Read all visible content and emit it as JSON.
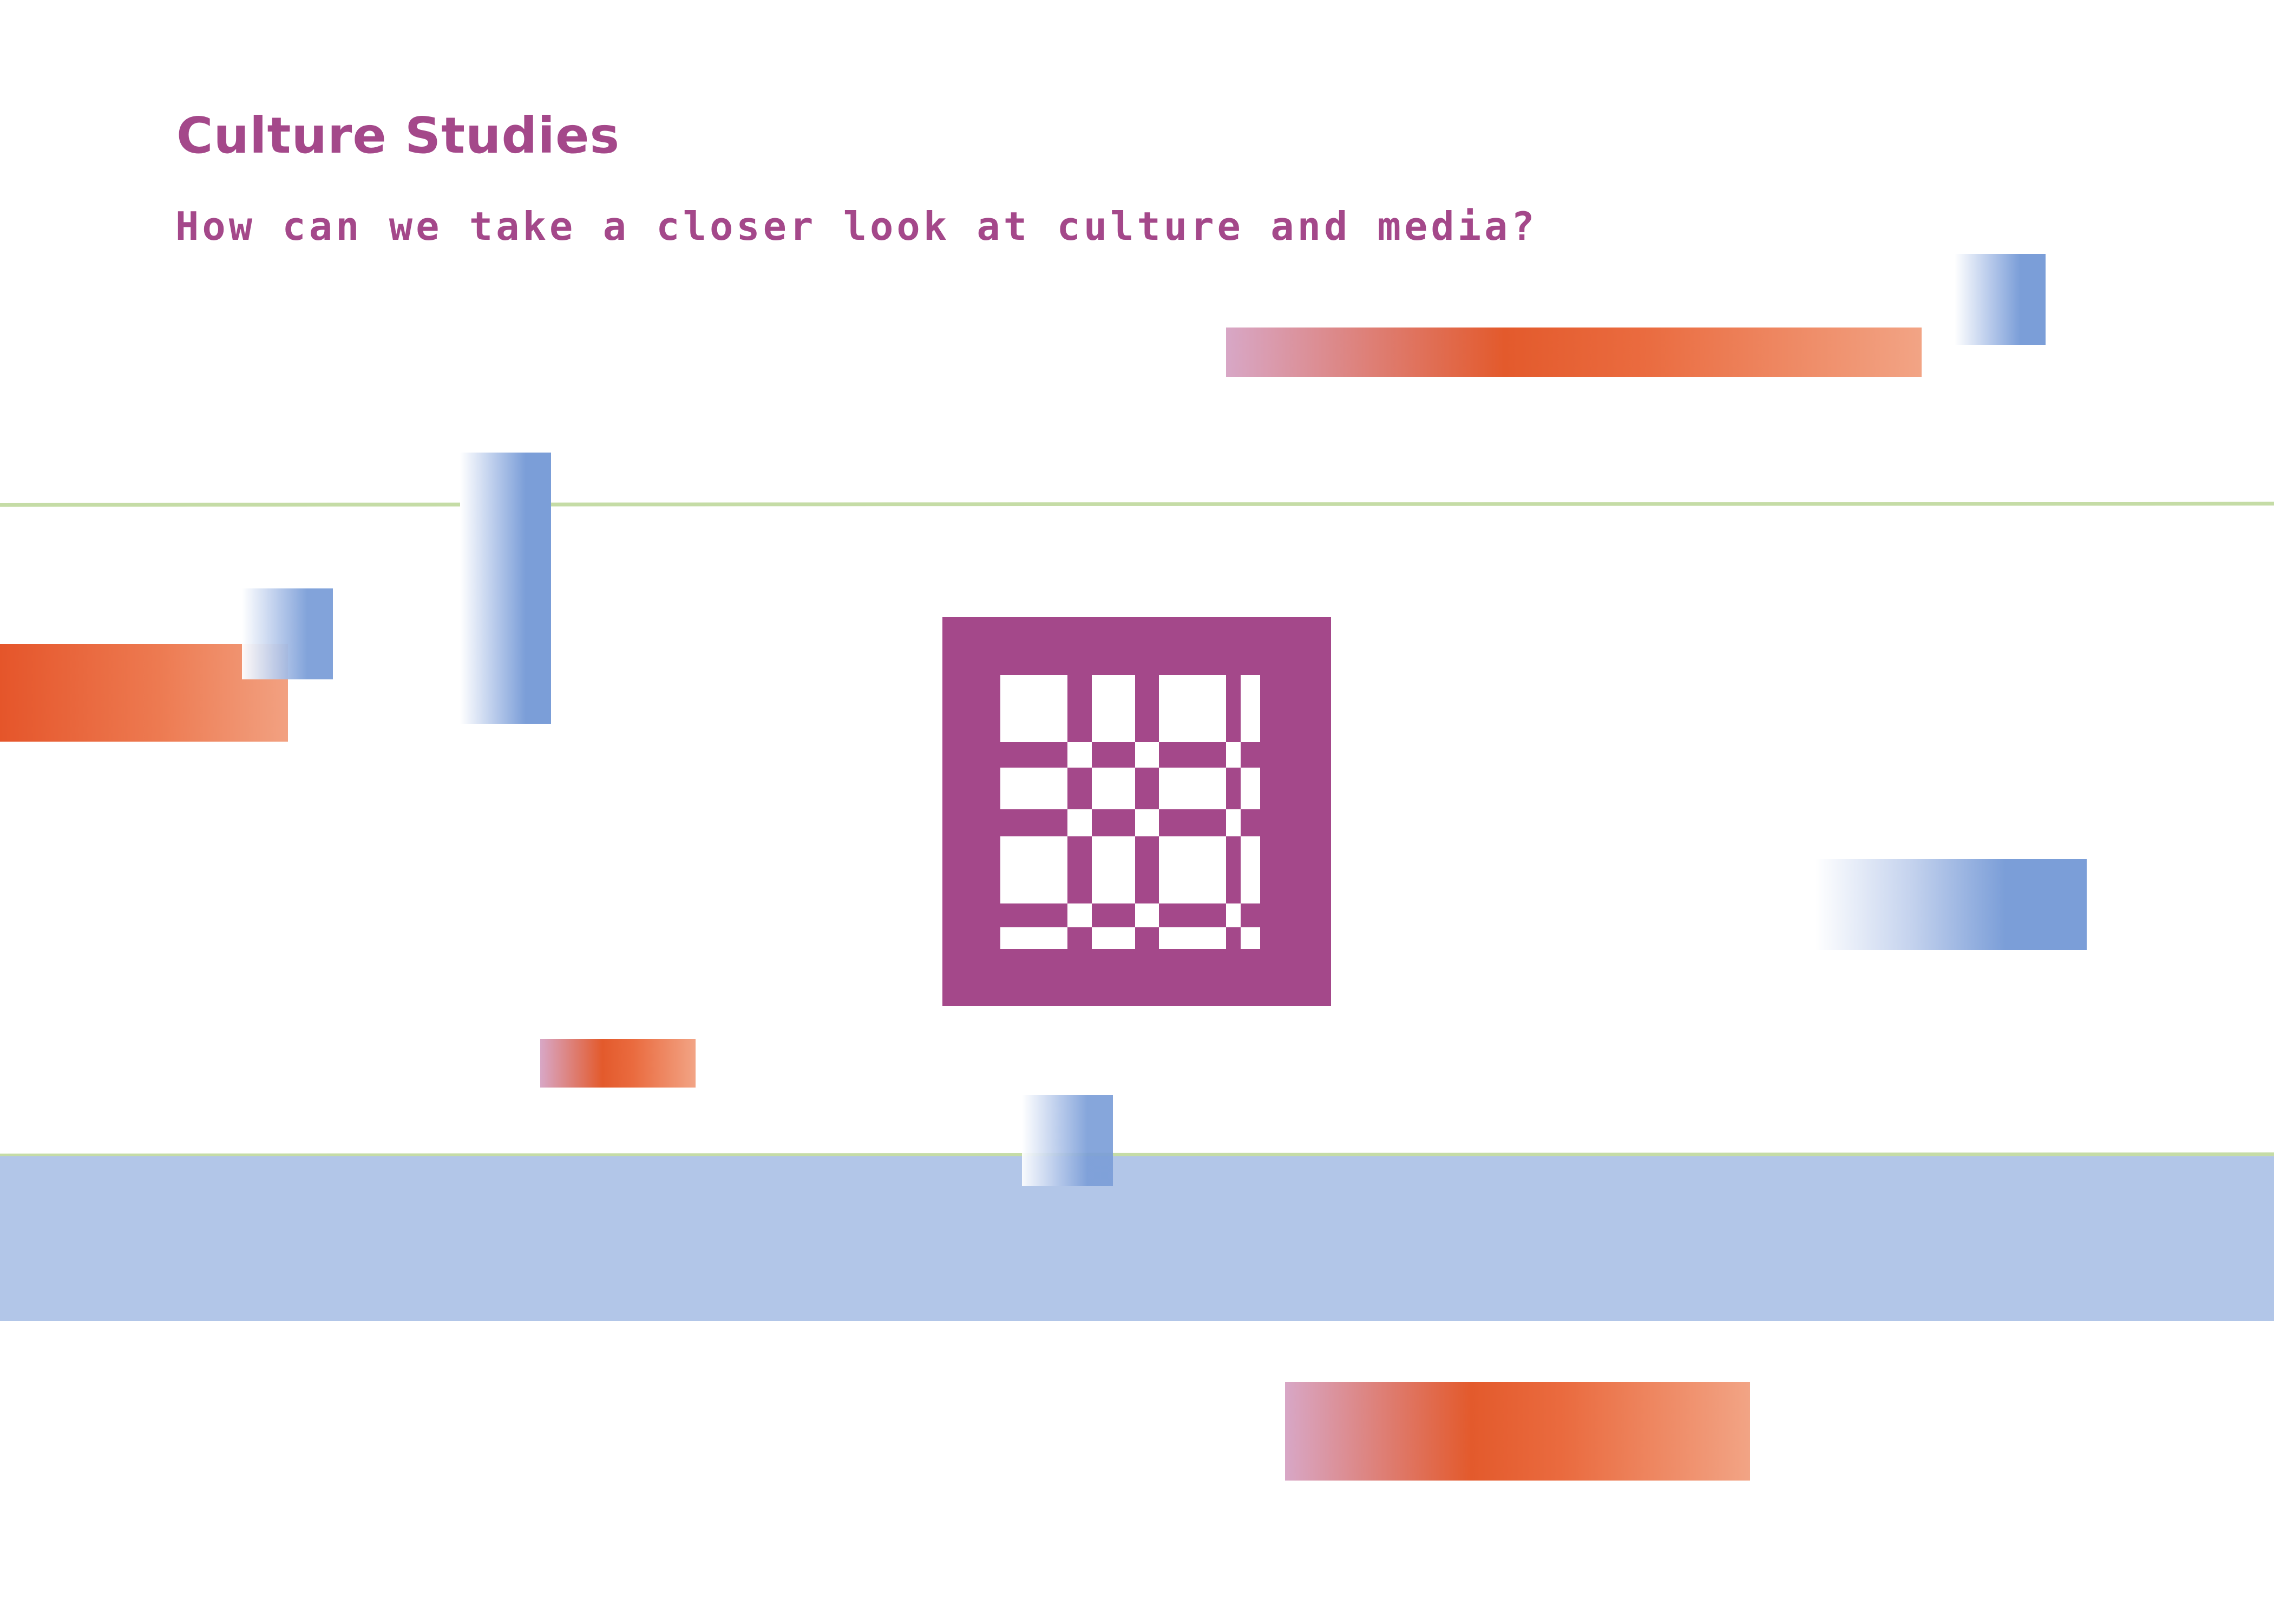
{
  "heading": {
    "title": "Culture Studies",
    "subtitle": "How can we take a closer look at culture and media?"
  },
  "colors": {
    "accent_magenta": "#a4488a",
    "orange": "#e35a2c",
    "blue": "#7b9ed8",
    "blue_band": "#b2c6e8",
    "green_line": "#c5dca6",
    "background": "#ffffff"
  },
  "icons": {
    "emblem": "grid-emblem-icon"
  }
}
